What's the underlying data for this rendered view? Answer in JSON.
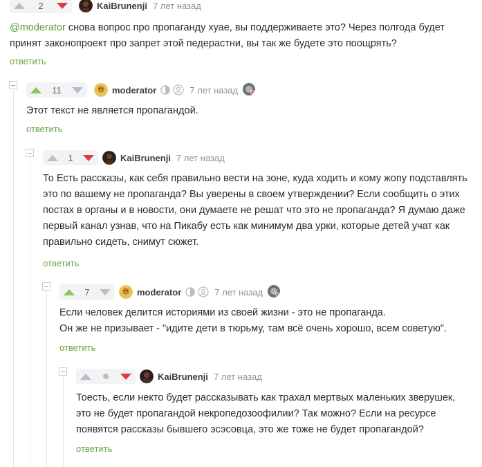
{
  "comments": [
    {
      "rating": "2",
      "user": "KaiBrunenji",
      "time": "7 лет назад",
      "mention": "@moderator",
      "text_rest": " снова вопрос про пропаганду хуае, вы поддерживаете это? Через полгода будет принят законопроект про запрет этой педерастни, вы так же будете это поощрять?",
      "reply": "ответить"
    },
    {
      "rating": "11",
      "user": "moderator",
      "time": "7 лет назад",
      "text": "Этот текст не является пропагандой.",
      "reply": "ответить"
    },
    {
      "rating": "1",
      "user": "KaiBrunenji",
      "time": "7 лет назад",
      "text": "То Есть рассказы, как себя правильно вести на зоне, куда ходить и кому жопу подставлять это по вашему не пропаганда? Вы уверены в своем утверждении? Если сообщить о этих постах в органы и в новости, они думаете не решат что это не пропаганда? Я думаю даже первый канал узнав, что на Пикабу есть как минимум два урки, которые детей учат как правильно сидеть, снимут сюжет.",
      "reply": "ответить"
    },
    {
      "rating": "7",
      "user": "moderator",
      "time": "7 лет назад",
      "text_line1": "Если человек делится историями из своей жизни - это не пропаганда.",
      "text_line2": "Он же не призывает - \"идите дети в тюрьму, там всё очень хорошо, всем советую\".",
      "reply": "ответить"
    },
    {
      "rating": "",
      "user": "KaiBrunenji",
      "time": "7 лет назад",
      "text": "Тоесть, если некто будет рассказывать как трахал мертвых маленьких зверушек, это не будет пропагандой некропедозоофилии? Так можно? Если на ресурсе появятся рассказы бывшего эсэсовца, это же тоже не будет пропагандой?",
      "reply": "ответить"
    }
  ],
  "colors": {
    "upvote": "#8ac858",
    "downvote_active": "#e03a3a",
    "link_green": "#63a442",
    "mention": "#5a9e3c"
  }
}
